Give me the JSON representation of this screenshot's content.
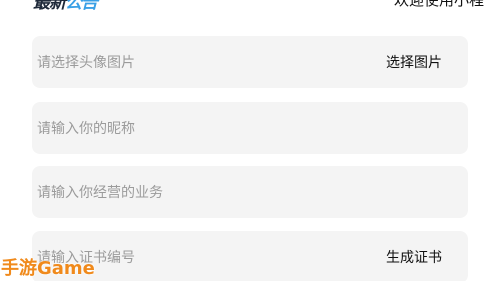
{
  "header": {
    "logo_text_main": "最新",
    "logo_text_accent": "公告",
    "welcome_text": "欢迎使用小程"
  },
  "form": {
    "fields": [
      {
        "placeholder": "请选择头像图片",
        "action": "选择图片"
      },
      {
        "placeholder": "请输入你的昵称"
      },
      {
        "placeholder": "请输入你经营的业务"
      },
      {
        "placeholder": "请输入证书编号",
        "action": "生成证书"
      }
    ]
  },
  "watermark": {
    "text": "手游Game"
  },
  "colors": {
    "field_background": "#f4f4f4",
    "placeholder_text": "#9b9b9b",
    "action_text": "#111111",
    "watermark": "#f08a1c",
    "logo_accent": "#3aa0e6"
  }
}
